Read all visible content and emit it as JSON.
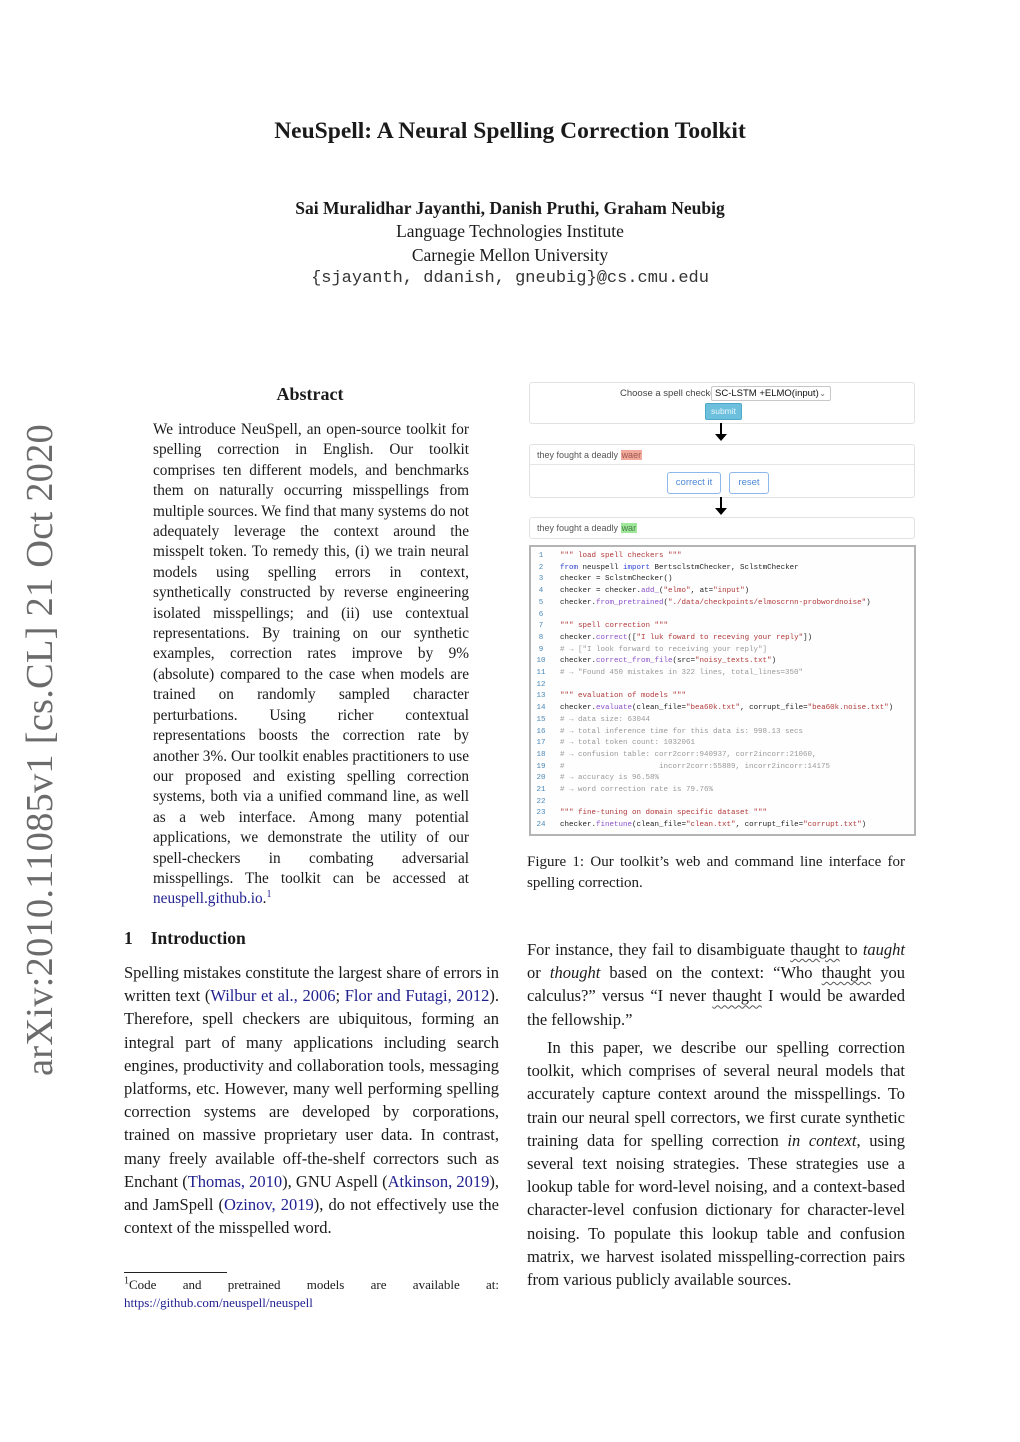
{
  "sidebar_stamp": "arXiv:2010.11085v1  [cs.CL]  21 Oct 2020",
  "header": {
    "title": "NeuSpell: A Neural Spelling Correction Toolkit",
    "authors": "Sai Muralidhar Jayanthi, Danish Pruthi, Graham Neubig",
    "affiliation_1": "Language Technologies Institute",
    "affiliation_2": "Carnegie Mellon University",
    "emails": "{sjayanth, ddanish, gneubig}@cs.cmu.edu"
  },
  "abstract": {
    "heading": "Abstract",
    "text_before_link": "We introduce NeuSpell, an open-source toolkit for spelling correction in English.  Our toolkit comprises ten different models, and benchmarks them on naturally occurring mis­spellings from multiple sources.  We find that many systems do not adequately leverage the context around the misspelt token.  To remedy this, (i) we train neural models using spelling errors in context, synthetically constructed by reverse engineering isolated misspellings; and (ii) use contextual representations. By training on our synthetic examples, correction rates im­prove by 9% (absolute) compared to the case when models are trained on randomly sampled character perturbations.  Using richer contex­tual representations boosts the correction rate by another 3%.  Our toolkit enables practition­ers to use our proposed and existing spelling correction systems, both via a unified com­mand line, as well as a web interface.  Among many potential applications, we demonstrate the utility of our spell-checkers in combating adversarial misspellings. The toolkit can be ac­cessed at ",
    "link_text": "neuspell.github.io",
    "text_after_link": ".",
    "footnote_mark": "1"
  },
  "introduction": {
    "number": "1",
    "heading": "Introduction",
    "p1_a": "Spelling mistakes constitute the largest share of errors in written text (",
    "cite_wilbur": "Wilbur et al., 2006",
    "p1_sep": "; ",
    "cite_flor": "Flor and Futagi, 2012",
    "p1_b": ").  Therefore, spell checkers are ubiquitous, forming an integral part of many ap­plications including search engines, productivity and collaboration tools, messaging platforms, etc. However, many well performing spelling correc­tion systems are developed by corporations, trained on massive proprietary user data. In contrast, many freely available off-the-shelf correctors such as En­chant (",
    "cite_thomas": "Thomas, 2010",
    "p1_c": "), GNU Aspell (",
    "cite_atkinson": "Atkinson, 2019",
    "p1_d": "), and JamSpell (",
    "cite_ozinov": "Ozinov, 2019",
    "p1_e": "), do not ef­fectively use the context of the misspelled word."
  },
  "footnote": {
    "mark": "1",
    "text": "Code and pretrained models are available at:",
    "url": "https://github.com/neuspell/neuspell"
  },
  "figure": {
    "choose_label": "Choose a spell checker",
    "selected_checker": "SC-LSTM +ELMO(input)",
    "submit_label": "submit",
    "input_sentence_prefix": "they fought a deadly ",
    "input_error_word": "waer",
    "correct_label": "correct it",
    "reset_label": "reset",
    "output_sentence_prefix": "they fought a deadly ",
    "output_corrected_word": "war",
    "highlight_colors": {
      "error": "#f2a89a",
      "corrected": "#9ee89a",
      "submit": "#6cc0dd"
    },
    "code_lines": [
      {
        "n": "1",
        "parts": [
          {
            "t": "\"\"\" load spell checkers \"\"\"",
            "c": "doc"
          }
        ]
      },
      {
        "n": "2",
        "parts": [
          {
            "t": "from",
            "c": "kw"
          },
          {
            "t": " neuspell ",
            "c": ""
          },
          {
            "t": "import",
            "c": "kw"
          },
          {
            "t": " BertsclstmChecker, SclstmChecker",
            "c": ""
          }
        ]
      },
      {
        "n": "3",
        "parts": [
          {
            "t": "checker = SclstmChecker()",
            "c": ""
          }
        ]
      },
      {
        "n": "4",
        "parts": [
          {
            "t": "checker = checker.",
            "c": ""
          },
          {
            "t": "add_",
            "c": "fn"
          },
          {
            "t": "(",
            "c": ""
          },
          {
            "t": "\"elmo\"",
            "c": "str"
          },
          {
            "t": ", at=",
            "c": ""
          },
          {
            "t": "\"input\"",
            "c": "str"
          },
          {
            "t": ")",
            "c": ""
          }
        ]
      },
      {
        "n": "5",
        "parts": [
          {
            "t": "checker.",
            "c": ""
          },
          {
            "t": "from_pretrained",
            "c": "fn"
          },
          {
            "t": "(",
            "c": ""
          },
          {
            "t": "\"./data/checkpoints/elmoscrnn-probwordnoise\"",
            "c": "str"
          },
          {
            "t": ")",
            "c": ""
          }
        ]
      },
      {
        "n": "6",
        "parts": []
      },
      {
        "n": "7",
        "parts": [
          {
            "t": "\"\"\" spell correction \"\"\"",
            "c": "doc"
          }
        ]
      },
      {
        "n": "8",
        "parts": [
          {
            "t": "checker.",
            "c": ""
          },
          {
            "t": "correct",
            "c": "fn"
          },
          {
            "t": "([",
            "c": ""
          },
          {
            "t": "\"I luk foward to receving your reply\"",
            "c": "str"
          },
          {
            "t": "])",
            "c": ""
          }
        ]
      },
      {
        "n": "9",
        "parts": [
          {
            "t": "# → [\"I look forward to receiving your reply\"]",
            "c": "cm"
          }
        ]
      },
      {
        "n": "10",
        "parts": [
          {
            "t": "checker.",
            "c": ""
          },
          {
            "t": "correct_from_file",
            "c": "fn"
          },
          {
            "t": "(src=",
            "c": ""
          },
          {
            "t": "\"noisy_texts.txt\"",
            "c": "str"
          },
          {
            "t": ")",
            "c": ""
          }
        ]
      },
      {
        "n": "11",
        "parts": [
          {
            "t": "# → \"Found 450 mistakes in 322 lines, total_lines=350\"",
            "c": "cm"
          }
        ]
      },
      {
        "n": "12",
        "parts": []
      },
      {
        "n": "13",
        "parts": [
          {
            "t": "\"\"\" evaluation of models \"\"\"",
            "c": "doc"
          }
        ]
      },
      {
        "n": "14",
        "parts": [
          {
            "t": "checker.",
            "c": ""
          },
          {
            "t": "evaluate",
            "c": "fn"
          },
          {
            "t": "(clean_file=",
            "c": ""
          },
          {
            "t": "\"bea60k.txt\"",
            "c": "str"
          },
          {
            "t": ", corrupt_file=",
            "c": ""
          },
          {
            "t": "\"bea60k.noise.txt\"",
            "c": "str"
          },
          {
            "t": ")",
            "c": ""
          }
        ]
      },
      {
        "n": "15",
        "parts": [
          {
            "t": "# → data size: 63044",
            "c": "cm"
          }
        ]
      },
      {
        "n": "16",
        "parts": [
          {
            "t": "# → total inference time for this data is: 998.13 secs",
            "c": "cm"
          }
        ]
      },
      {
        "n": "17",
        "parts": [
          {
            "t": "# → total token count: 1032061",
            "c": "cm"
          }
        ]
      },
      {
        "n": "18",
        "parts": [
          {
            "t": "# → confusion table: corr2corr:940937, corr2incorr:21060,",
            "c": "cm"
          }
        ]
      },
      {
        "n": "19",
        "parts": [
          {
            "t": "#                     incorr2corr:55889, incorr2incorr:14175",
            "c": "cm"
          }
        ]
      },
      {
        "n": "20",
        "parts": [
          {
            "t": "# → accuracy is 96.58%",
            "c": "cm"
          }
        ]
      },
      {
        "n": "21",
        "parts": [
          {
            "t": "# → word correction rate is 79.76%",
            "c": "cm"
          }
        ]
      },
      {
        "n": "22",
        "parts": []
      },
      {
        "n": "23",
        "parts": [
          {
            "t": "\"\"\" fine-tuning on domain specific dataset \"\"\"",
            "c": "doc"
          }
        ]
      },
      {
        "n": "24",
        "parts": [
          {
            "t": "checker.",
            "c": ""
          },
          {
            "t": "finetune",
            "c": "fn"
          },
          {
            "t": "(clean_file=",
            "c": ""
          },
          {
            "t": "\"clean.txt\"",
            "c": "str"
          },
          {
            "t": ", corrupt_file=",
            "c": ""
          },
          {
            "t": "\"corrupt.txt\"",
            "c": "str"
          },
          {
            "t": ")",
            "c": ""
          }
        ]
      }
    ],
    "caption": "Figure 1:  Our toolkit’s web and command line inter­face for spelling correction."
  },
  "right_column": {
    "p1_a": "For instance, they fail to disambiguate ",
    "wavy_word": "thaught",
    "p1_b": " to ",
    "italic_1": "taught",
    "p1_c": " or ",
    "italic_2": "thought",
    "p1_d": " based on the context:  “Who ",
    "p1_e": " you calculus?” versus “I never ",
    "p1_f": " I would be awarded the fellowship.”",
    "p2_a": "In this paper, we describe our spelling correction toolkit, which comprises of several neural mod­els that accurately capture context around the mis­spellings. To train our neural spell correctors, we first curate synthetic training data for spelling cor­rection ",
    "p2_italic": "in context",
    "p2_b": ", using several text noising strate­gies. These strategies use a lookup table for word-level noising, and a context-based character-level confusion dictionary for character-level noising. To populate this lookup table and confusion matrix, we harvest isolated misspelling-correction pairs from various publicly available sources."
  }
}
